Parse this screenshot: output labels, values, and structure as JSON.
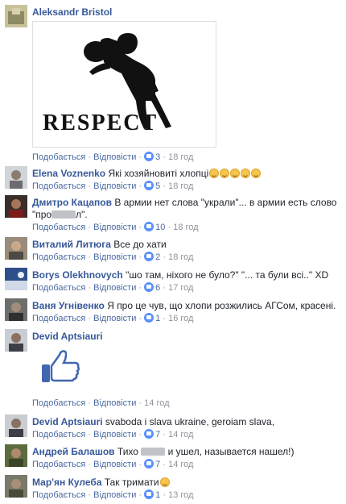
{
  "labels": {
    "like": "Подобається",
    "reply": "Відповісти",
    "dot": "·"
  },
  "comments": [
    {
      "author": "Aleksandr Bristol",
      "text": "",
      "image_caption": "RESPECT",
      "likes": "3",
      "time": "18 год"
    },
    {
      "author": "Elena Voznenko",
      "text": "Які хозяйновиті хлопці",
      "likes": "5",
      "time": "18 год"
    },
    {
      "author": "Дмитро Кацапов",
      "text": "В армии нет слова \"украли\"... в армии есть слово \"про",
      "text_end": "л\".",
      "likes": "10",
      "time": "18 год"
    },
    {
      "author": "Виталий Литюга",
      "text": "Все до хати",
      "likes": "2",
      "time": "18 год"
    },
    {
      "author": "Borys Olekhnovych",
      "text": "\"шо там, ніхого не було?\" \"... та були всі..\" XD",
      "likes": "6",
      "time": "17 год"
    },
    {
      "author": "Ваня Угнівенко",
      "text": "Я про це чув, що хлопи розжились АГСом, красені.",
      "likes": "1",
      "time": "16 год"
    },
    {
      "author": "Devid Aptsiauri",
      "text": "",
      "likes": "",
      "time": "14 год"
    },
    {
      "author": "Devid Aptsiauri",
      "text": "svaboda i slava ukraine, geroiam slava,",
      "likes": "7",
      "time": "14 год"
    },
    {
      "author": "Андрей Балашов",
      "text": "Тихо",
      "text_end": "и ушел, называется нашел!)",
      "likes": "7",
      "time": "14 год"
    },
    {
      "author": "Мар'ян Кулеба",
      "text": "Так тримати",
      "likes": "1",
      "time": "13 год"
    }
  ]
}
